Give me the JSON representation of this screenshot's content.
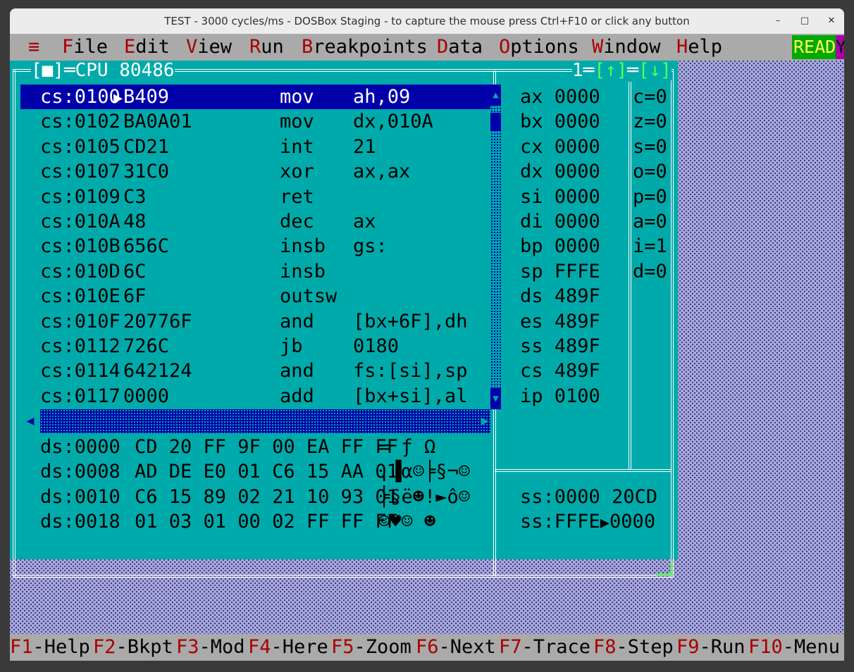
{
  "window": {
    "title": "TEST - 3000 cycles/ms - DOSBox Staging - to capture the mouse press Ctrl+F10 or click any button",
    "controls": [
      "–",
      "□",
      "✕"
    ]
  },
  "menu": {
    "system": "≡",
    "items": [
      {
        "hotkey": "F",
        "rest": "ile"
      },
      {
        "hotkey": "E",
        "rest": "dit"
      },
      {
        "hotkey": "V",
        "rest": "iew"
      },
      {
        "hotkey": "R",
        "rest": "un"
      },
      {
        "hotkey": "B",
        "rest": "reakpoints"
      },
      {
        "hotkey": "D",
        "rest": "ata"
      },
      {
        "hotkey": "O",
        "rest": "ptions"
      },
      {
        "hotkey": "W",
        "rest": "indow"
      },
      {
        "hotkey": "H",
        "rest": "elp"
      }
    ],
    "status": "READY",
    "status_tail": "Y"
  },
  "cpu_window": {
    "close_box": "[■]",
    "title": "CPU 80486",
    "number": "1",
    "arrows": [
      "[↑]",
      "[↓]"
    ],
    "selected_row": 0,
    "code": [
      {
        "addr": "cs:0100",
        "bytes": "B409",
        "mnemonic": "mov",
        "operands": "ah,09"
      },
      {
        "addr": "cs:0102",
        "bytes": "BA0A01",
        "mnemonic": "mov",
        "operands": "dx,010A"
      },
      {
        "addr": "cs:0105",
        "bytes": "CD21",
        "mnemonic": "int",
        "operands": "21"
      },
      {
        "addr": "cs:0107",
        "bytes": "31C0",
        "mnemonic": "xor",
        "operands": "ax,ax"
      },
      {
        "addr": "cs:0109",
        "bytes": "C3",
        "mnemonic": "ret",
        "operands": ""
      },
      {
        "addr": "cs:010A",
        "bytes": "48",
        "mnemonic": "dec",
        "operands": "ax"
      },
      {
        "addr": "cs:010B",
        "bytes": "656C",
        "mnemonic": "insb",
        "operands": "gs:"
      },
      {
        "addr": "cs:010D",
        "bytes": "6C",
        "mnemonic": "insb",
        "operands": ""
      },
      {
        "addr": "cs:010E",
        "bytes": "6F",
        "mnemonic": "outsw",
        "operands": ""
      },
      {
        "addr": "cs:010F",
        "bytes": "20776F",
        "mnemonic": "and",
        "operands": "[bx+6F],dh"
      },
      {
        "addr": "cs:0112",
        "bytes": "726C",
        "mnemonic": "jb",
        "operands": "0180"
      },
      {
        "addr": "cs:0114",
        "bytes": "642124",
        "mnemonic": "and",
        "operands": "fs:[si],sp"
      },
      {
        "addr": "cs:0117",
        "bytes": "0000",
        "mnemonic": "add",
        "operands": "[bx+si],al"
      }
    ],
    "registers": [
      {
        "name": "ax",
        "value": "0000"
      },
      {
        "name": "bx",
        "value": "0000"
      },
      {
        "name": "cx",
        "value": "0000"
      },
      {
        "name": "dx",
        "value": "0000"
      },
      {
        "name": "si",
        "value": "0000"
      },
      {
        "name": "di",
        "value": "0000"
      },
      {
        "name": "bp",
        "value": "0000"
      },
      {
        "name": "sp",
        "value": "FFFE"
      },
      {
        "name": "ds",
        "value": "489F"
      },
      {
        "name": "es",
        "value": "489F"
      },
      {
        "name": "ss",
        "value": "489F"
      },
      {
        "name": "cs",
        "value": "489F"
      },
      {
        "name": "ip",
        "value": "0100"
      }
    ],
    "flags": [
      {
        "name": "c",
        "value": "0"
      },
      {
        "name": "z",
        "value": "0"
      },
      {
        "name": "s",
        "value": "0"
      },
      {
        "name": "o",
        "value": "0"
      },
      {
        "name": "p",
        "value": "0"
      },
      {
        "name": "a",
        "value": "0"
      },
      {
        "name": "i",
        "value": "1"
      },
      {
        "name": "d",
        "value": "0"
      }
    ],
    "dump": [
      {
        "addr": "ds:0000",
        "hex": "CD 20 FF 9F 00 EA FF FF",
        "ascii": "= ƒ Ω"
      },
      {
        "addr": "ds:0008",
        "hex": "AD DE E0 01 C6 15 AA 01",
        "ascii": "¡▐α☺╞§¬☺"
      },
      {
        "addr": "ds:0010",
        "hex": "C6 15 89 02 21 10 93 01",
        "ascii": "╞§ë☻!►ô☺"
      },
      {
        "addr": "ds:0018",
        "hex": "01 03 01 00 02 FF FF FF",
        "ascii": "☺♥☺ ☻"
      }
    ],
    "stack": [
      {
        "addr": "ss:0000",
        "arrow": " ",
        "value": "20CD"
      },
      {
        "addr": "ss:FFFE",
        "arrow": "▶",
        "value": "0000"
      }
    ]
  },
  "function_keys": [
    {
      "key": "F1",
      "label": "-Help"
    },
    {
      "key": "F2",
      "label": "-Bkpt"
    },
    {
      "key": "F3",
      "label": "-Mod"
    },
    {
      "key": "F4",
      "label": "-Here"
    },
    {
      "key": "F5",
      "label": "-Zoom"
    },
    {
      "key": "F6",
      "label": "-Next"
    },
    {
      "key": "F7",
      "label": "-Trace"
    },
    {
      "key": "F8",
      "label": "-Step"
    },
    {
      "key": "F9",
      "label": "-Run"
    },
    {
      "key": "F10",
      "label": "-Menu"
    }
  ],
  "colors": {
    "window_bg": "#00aaaa",
    "selection": "#0000aa",
    "hotkey": "#aa0000",
    "bars": "#aaaaaa",
    "ready": "#00aa00"
  },
  "icons": {
    "system_menu": "hamburger-icon",
    "scroll_up": "triangle-up-icon",
    "scroll_down": "triangle-down-icon",
    "scroll_left": "triangle-left-icon",
    "scroll_right": "triangle-right-icon",
    "exec_pointer": "triangle-right-icon"
  }
}
